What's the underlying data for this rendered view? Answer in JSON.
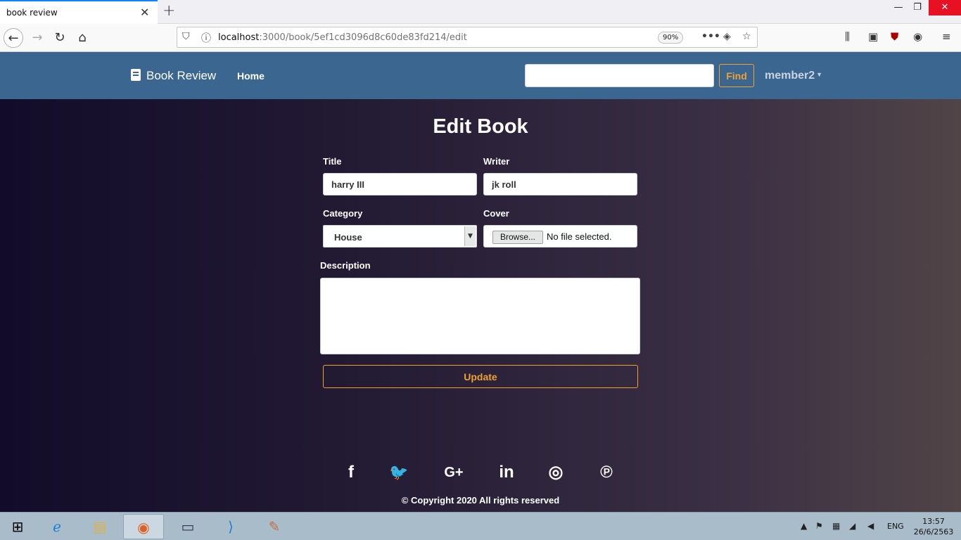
{
  "browser": {
    "tab_title": "book review",
    "tab_close": "✕",
    "new_tab": "+",
    "url_host": "localhost",
    "url_rest": ":3000/book/5ef1cd3096d8c60de83fd214/edit",
    "zoom": "90%",
    "window_controls": {
      "minimize": "—",
      "restore": "❐",
      "close": "✕"
    }
  },
  "site_nav": {
    "brand": "Book Review",
    "home": "Home",
    "search_value": "",
    "find": "Find",
    "user": "member2"
  },
  "form": {
    "heading": "Edit Book",
    "title_label": "Title",
    "title_value": "harry III",
    "writer_label": "Writer",
    "writer_value": "jk roll",
    "category_label": "Category",
    "category_value": "House",
    "cover_label": "Cover",
    "browse": "Browse...",
    "file_status": "No file selected.",
    "description_label": "Description",
    "description_value": "",
    "update": "Update"
  },
  "footer": {
    "social": [
      {
        "icon": "facebook-icon",
        "glyph": "f"
      },
      {
        "icon": "twitter-icon",
        "glyph": "🐦"
      },
      {
        "icon": "google-plus-icon",
        "glyph": "G+"
      },
      {
        "icon": "linkedin-icon",
        "glyph": "in"
      },
      {
        "icon": "instagram-icon",
        "glyph": "◎"
      },
      {
        "icon": "pinterest-icon",
        "glyph": "℗"
      }
    ],
    "copyright": "© Copyright 2020 All rights reserved"
  },
  "taskbar": {
    "lang": "ENG",
    "time": "13:57",
    "date": "26/6/2563"
  },
  "colors": {
    "navbar": "#3b6690",
    "accent": "#f0a030"
  }
}
